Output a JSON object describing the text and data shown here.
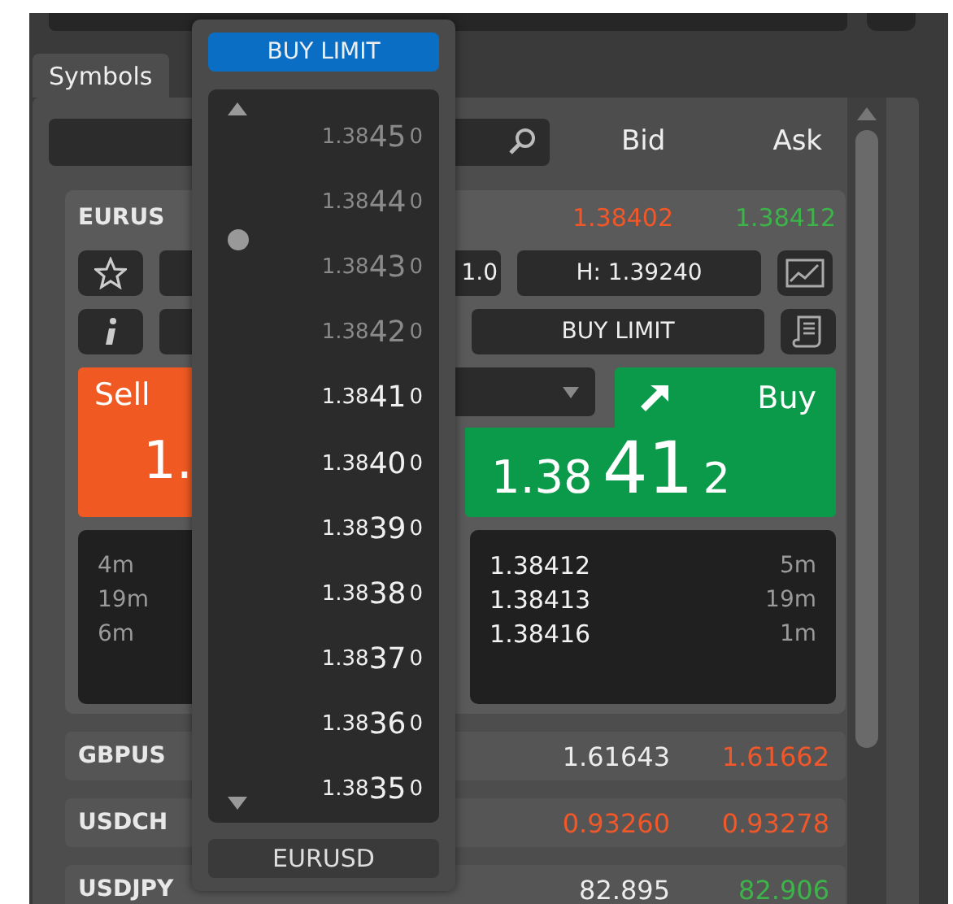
{
  "tab": {
    "label": "Symbols",
    "selected": true
  },
  "columns": [
    "Bid",
    "Ask"
  ],
  "card": {
    "name": "EURUS",
    "bid": {
      "text": "1.38402",
      "color": "#f0582a"
    },
    "ask": {
      "text": "1.38412",
      "color": "#3db34a"
    },
    "volume": "1.0",
    "high": "H: 1.39240",
    "order_type": "BUY LIMIT",
    "sell": {
      "label": "Sell",
      "price": "1."
    },
    "buy": {
      "label": "Buy",
      "price_head": "1.38",
      "price_big": "41",
      "price_tail": "2"
    },
    "sell_depth": [
      {
        "time": "4m"
      },
      {
        "time": "19m"
      },
      {
        "time": "6m"
      }
    ],
    "buy_depth": [
      {
        "price": "1.38412",
        "time": "5m"
      },
      {
        "price": "1.38413",
        "time": "19m"
      },
      {
        "price": "1.38416",
        "time": "1m"
      }
    ]
  },
  "symbols": [
    {
      "name": "GBPUS",
      "bid": {
        "text": "1.61643",
        "color": "#ececec"
      },
      "ask": {
        "text": "1.61662",
        "color": "#f0582a"
      }
    },
    {
      "name": "USDCH",
      "bid": {
        "text": "0.93260",
        "color": "#f0582a"
      },
      "ask": {
        "text": "0.93278",
        "color": "#f0582a"
      }
    },
    {
      "name": "USDJPY",
      "bid": {
        "text": "82.895",
        "color": "#ececec"
      },
      "ask": {
        "text": "82.906",
        "color": "#3db34a"
      }
    }
  ],
  "ladder": {
    "order_type": "BUY LIMIT",
    "symbol": "EURUSD",
    "levels": [
      {
        "head": "1.38",
        "big": "45",
        "tail": "0",
        "dimmed": true
      },
      {
        "head": "1.38",
        "big": "44",
        "tail": "0",
        "dimmed": true
      },
      {
        "head": "1.38",
        "big": "43",
        "tail": "0",
        "dimmed": true
      },
      {
        "head": "1.38",
        "big": "42",
        "tail": "0",
        "dimmed": true
      },
      {
        "head": "1.38",
        "big": "41",
        "tail": "0",
        "dimmed": false
      },
      {
        "head": "1.38",
        "big": "40",
        "tail": "0",
        "dimmed": false
      },
      {
        "head": "1.38",
        "big": "39",
        "tail": "0",
        "dimmed": false
      },
      {
        "head": "1.38",
        "big": "38",
        "tail": "0",
        "dimmed": false
      },
      {
        "head": "1.38",
        "big": "37",
        "tail": "0",
        "dimmed": false
      },
      {
        "head": "1.38",
        "big": "36",
        "tail": "0",
        "dimmed": false
      },
      {
        "head": "1.38",
        "big": "35",
        "tail": "0",
        "dimmed": false
      }
    ]
  }
}
